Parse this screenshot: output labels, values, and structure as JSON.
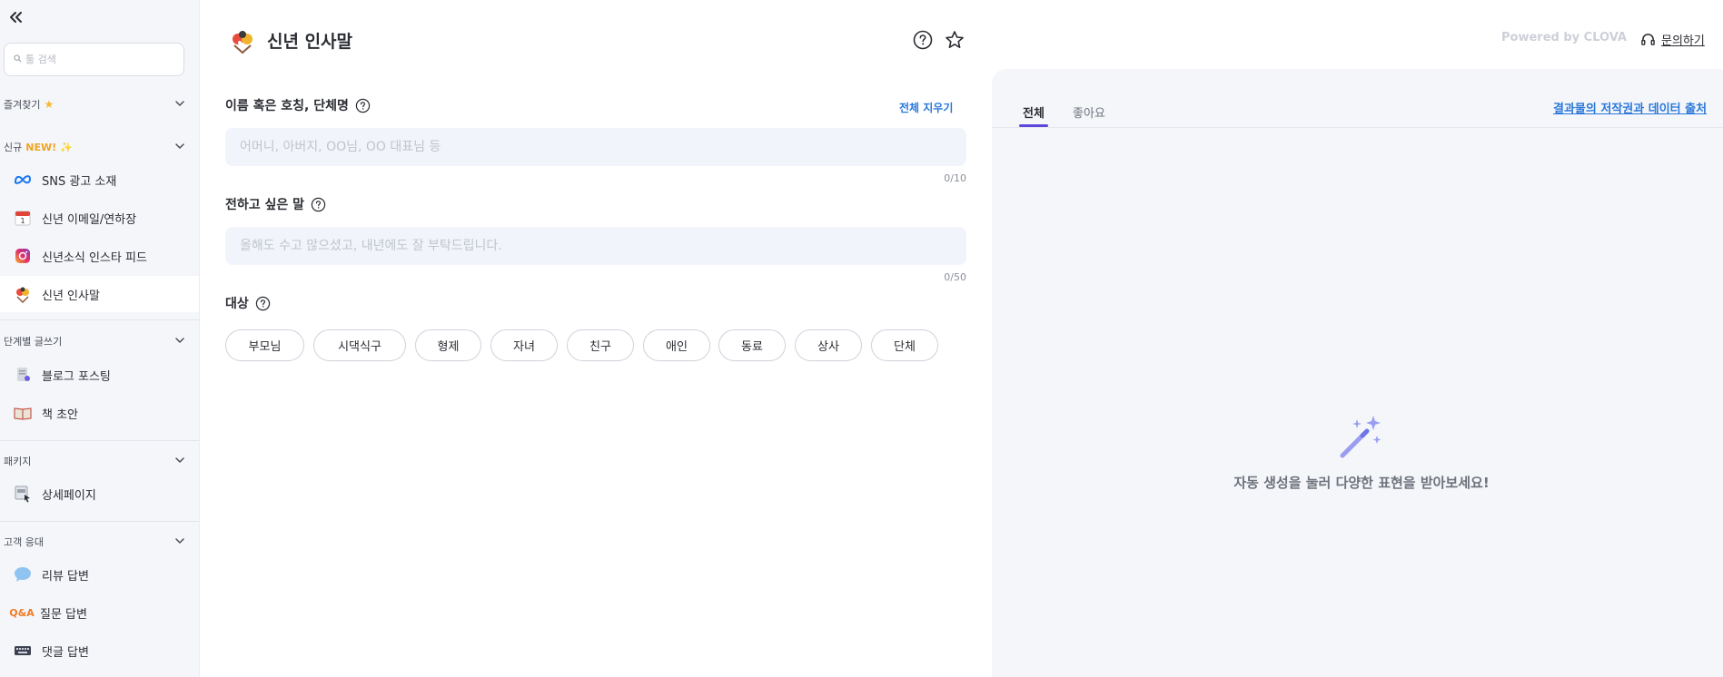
{
  "sidebar": {
    "collapse_icon": "double-chevron-left-icon",
    "search_placeholder": "툴 검색",
    "sections": {
      "favorites": "즐겨찾기",
      "new": "신규",
      "new_badge": "NEW! ✨",
      "stepwise": "단계별 글쓰기",
      "package": "패키지",
      "customer": "고객 응대"
    },
    "items": [
      {
        "label": "SNS 광고 소재",
        "icon": "meta-logo-icon"
      },
      {
        "label": "신년 이메일/연하장",
        "icon": "calendar-icon"
      },
      {
        "label": "신년소식 인스타 피드",
        "icon": "instagram-icon"
      },
      {
        "label": "신년 인사말",
        "icon": "new-year-greeting-icon"
      },
      {
        "label": "블로그 포스팅",
        "icon": "blog-doc-icon"
      },
      {
        "label": "책 초안",
        "icon": "book-icon"
      },
      {
        "label": "상세페이지",
        "icon": "detail-page-icon"
      },
      {
        "label": "리뷰 답변",
        "icon": "speech-bubble-icon"
      },
      {
        "label": "질문 답변",
        "icon": "qa-icon"
      },
      {
        "label": "댓글 답변",
        "icon": "keyboard-icon"
      }
    ],
    "qa_text": "Q&A"
  },
  "header": {
    "title": "신년 인사말",
    "powered_by": "Powered by CLOVA",
    "inquiry": "문의하기"
  },
  "form": {
    "name_label": "이름 혹은 호칭, 단체명",
    "clear_all": "전체 지우기",
    "name_placeholder": "어머니, 아버지, OO님, OO 대표님 등",
    "name_counter": "0/10",
    "message_label": "전하고 싶은 말",
    "message_placeholder": "올해도 수고 많으셨고, 내년에도 잘 부탁드립니다.",
    "message_counter": "0/50",
    "target_label": "대상",
    "targets": [
      "부모님",
      "시댁식구",
      "형제",
      "자녀",
      "친구",
      "애인",
      "동료",
      "상사",
      "단체"
    ]
  },
  "results": {
    "tabs": [
      "전체",
      "좋아요"
    ],
    "copyright_link": "결과물의 저작권과 데이터 출처",
    "empty_message": "자동 생성을 눌러 다양한 표현을 받아보세요!"
  },
  "colors": {
    "accent_blue": "#2b78d9",
    "tab_indicator": "#5b46d9",
    "new_badge": "#f0a320"
  }
}
